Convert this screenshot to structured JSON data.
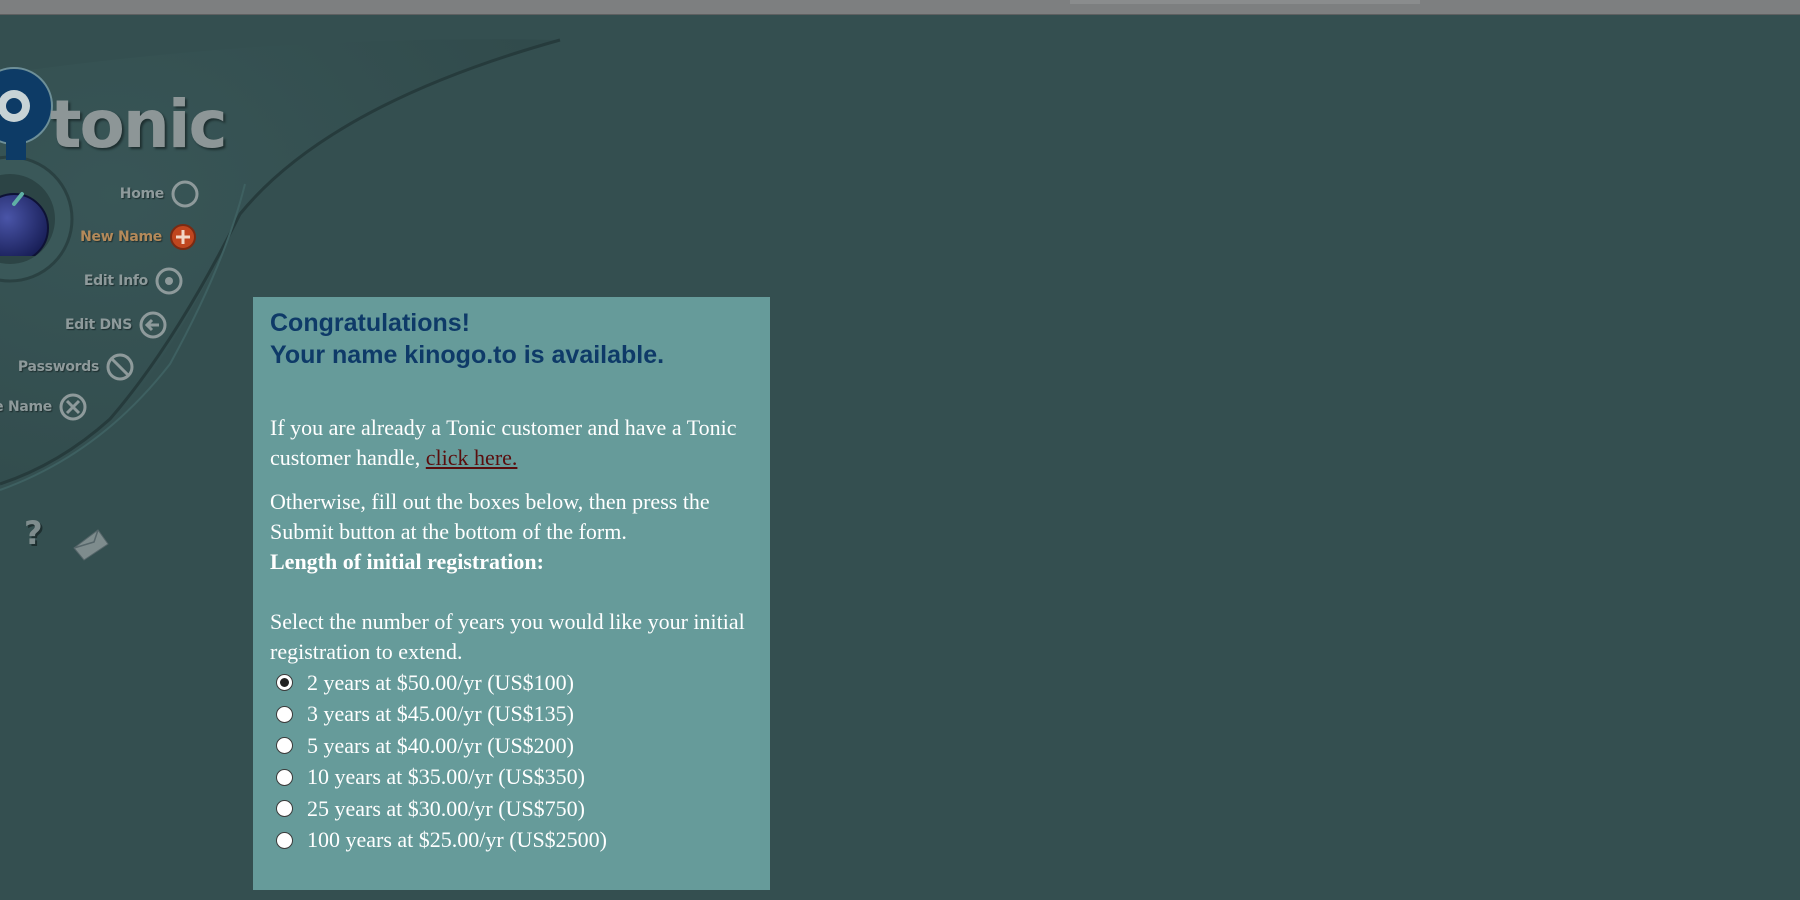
{
  "logo": {
    "text": "tonic"
  },
  "nav": [
    {
      "label": "Home",
      "icon": "circle-icon"
    },
    {
      "label": "New Name",
      "icon": "plus-circle-icon"
    },
    {
      "label": "Edit Info",
      "icon": "target-icon"
    },
    {
      "label": "Edit DNS",
      "icon": "arrow-left-circle-icon"
    },
    {
      "label": "Passwords",
      "icon": "no-entry-icon"
    },
    {
      "label": "e Name",
      "icon": "x-circle-icon"
    }
  ],
  "help": {
    "icon": "question-mark-icon"
  },
  "mail": {
    "icon": "envelope-icon"
  },
  "content": {
    "title1": "Congratulations!",
    "title2": "Your name kinogo.to is available.",
    "customer_text": "If you are already a Tonic customer and have a Tonic customer handle, ",
    "customer_link": "click here.",
    "otherwise_text": "Otherwise, fill out the boxes below, then press the Submit button at the bottom of the form.",
    "length_heading": "Length of initial registration:",
    "select_text": "Select the number of years you would like your initial registration to extend.",
    "options": [
      {
        "label": "2 years at $50.00/yr (US$100)",
        "selected": true
      },
      {
        "label": "3 years at $45.00/yr (US$135)",
        "selected": false
      },
      {
        "label": "5 years at $40.00/yr (US$200)",
        "selected": false
      },
      {
        "label": "10 years at $35.00/yr (US$350)",
        "selected": false
      },
      {
        "label": "25 years at $30.00/yr (US$750)",
        "selected": false
      },
      {
        "label": "100 years at $25.00/yr (US$2500)",
        "selected": false
      }
    ]
  },
  "colors": {
    "page_background": "#344f50",
    "panel_background": "#669b9a",
    "title": "#0e3a68",
    "link": "#5a0d0d",
    "new_name_accent": "#c0461f"
  }
}
